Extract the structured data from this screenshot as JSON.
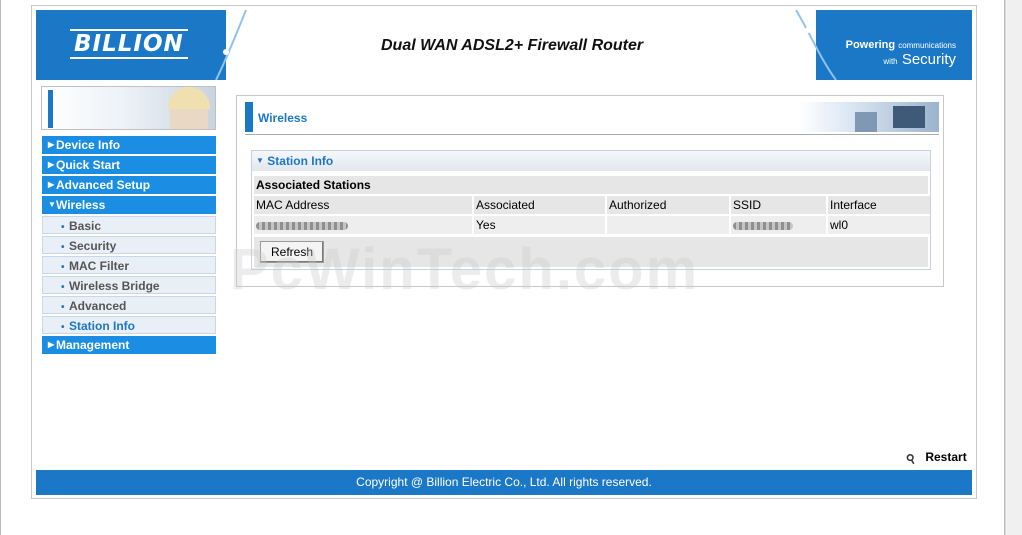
{
  "header": {
    "logo": "BILLION",
    "title": "Dual WAN ADSL2+ Firewall Router",
    "tagline_powering": "Powering",
    "tagline_communications": "communications",
    "tagline_with": "with",
    "tagline_security": "Security"
  },
  "sidebar": {
    "items": [
      {
        "label": "Device Info",
        "type": "top",
        "expanded": false
      },
      {
        "label": "Quick Start",
        "type": "top",
        "expanded": false
      },
      {
        "label": "Advanced Setup",
        "type": "top",
        "expanded": false
      },
      {
        "label": "Wireless",
        "type": "top",
        "expanded": true
      },
      {
        "label": "Basic",
        "type": "sub"
      },
      {
        "label": "Security",
        "type": "sub"
      },
      {
        "label": "MAC Filter",
        "type": "sub"
      },
      {
        "label": "Wireless Bridge",
        "type": "sub"
      },
      {
        "label": "Advanced",
        "type": "sub"
      },
      {
        "label": "Station Info",
        "type": "sub",
        "active": true
      },
      {
        "label": "Management",
        "type": "top",
        "expanded": false
      }
    ]
  },
  "main": {
    "page_title": "Wireless",
    "section_title": "Station Info",
    "table_caption": "Associated Stations",
    "columns": [
      "MAC Address",
      "Associated",
      "Authorized",
      "SSID",
      "Interface"
    ],
    "rows": [
      {
        "mac": "",
        "associated": "Yes",
        "authorized": "",
        "ssid": "",
        "interface": "wl0"
      }
    ],
    "refresh_label": "Refresh"
  },
  "watermark": "PcWinTech.com",
  "restart_label": "Restart",
  "footer": "Copyright @ Billion Electric Co., Ltd. All rights reserved.",
  "colors": {
    "accent": "#1b78c6",
    "nav": "#1b8ee3"
  }
}
